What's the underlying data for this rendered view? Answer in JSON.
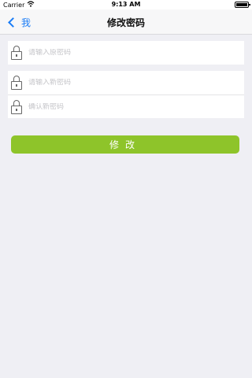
{
  "status_bar": {
    "carrier": "Carrier",
    "time": "9:13 AM"
  },
  "nav": {
    "back_label": "我",
    "title": "修改密码"
  },
  "fields": {
    "old_password": {
      "placeholder": "请输入原密码",
      "value": ""
    },
    "new_password": {
      "placeholder": "请输入新密码",
      "value": ""
    },
    "confirm_password": {
      "placeholder": "确认新密码",
      "value": ""
    }
  },
  "submit": {
    "label": "修改"
  },
  "colors": {
    "accent_blue": "#1a7cf6",
    "button_green": "#8ec42a",
    "background": "#efeff4"
  },
  "icons": {
    "lock": "lock-icon",
    "back": "chevron-left-icon",
    "wifi": "wifi-icon",
    "battery": "battery-icon"
  }
}
